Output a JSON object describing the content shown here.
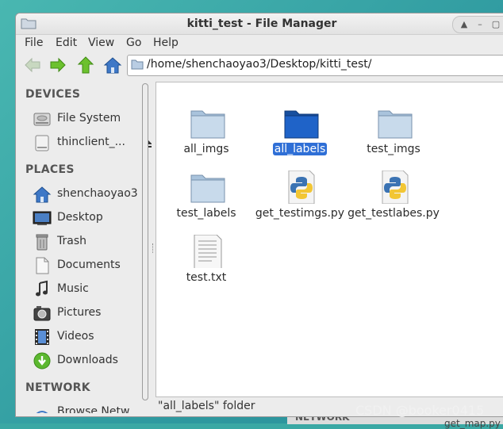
{
  "window": {
    "title": "kitti_test - File Manager"
  },
  "menu": {
    "items": [
      "File",
      "Edit",
      "View",
      "Go",
      "Help"
    ]
  },
  "toolbar": {
    "path": "/home/shenchaoyao3/Desktop/kitti_test/"
  },
  "sidebar": {
    "devices_header": "DEVICES",
    "devices": [
      {
        "label": "File System",
        "icon": "harddisk-icon"
      },
      {
        "label": "thinclient_...",
        "icon": "drive-icon",
        "eject": true
      }
    ],
    "places_header": "PLACES",
    "places": [
      {
        "label": "shenchaoyao3",
        "icon": "home-icon"
      },
      {
        "label": "Desktop",
        "icon": "desktop-icon"
      },
      {
        "label": "Trash",
        "icon": "trash-icon"
      },
      {
        "label": "Documents",
        "icon": "documents-icon"
      },
      {
        "label": "Music",
        "icon": "music-icon"
      },
      {
        "label": "Pictures",
        "icon": "pictures-icon"
      },
      {
        "label": "Videos",
        "icon": "videos-icon"
      },
      {
        "label": "Downloads",
        "icon": "downloads-icon"
      }
    ],
    "network_header": "NETWORK",
    "network": [
      {
        "label": "Browse Netw",
        "icon": "network-icon"
      }
    ]
  },
  "files": [
    {
      "name": "all_imgs",
      "type": "folder",
      "selected": false
    },
    {
      "name": "all_labels",
      "type": "folder",
      "selected": true
    },
    {
      "name": "test_imgs",
      "type": "folder",
      "selected": false
    },
    {
      "name": "test_labels",
      "type": "folder",
      "selected": false
    },
    {
      "name": "get_testimgs.py",
      "type": "python",
      "selected": false
    },
    {
      "name": "get_testlabes.py",
      "type": "python",
      "selected": false
    },
    {
      "name": "test.txt",
      "type": "text",
      "selected": false
    }
  ],
  "status": {
    "text": "\"all_labels\" folder"
  },
  "background": {
    "network_label": "NETWORK",
    "partial_file": "get_map.py"
  },
  "watermark": "CSDN @booker0415",
  "colors": {
    "selection": "#2f6fd6",
    "folder": "#8fb3d6",
    "selected_folder": "#1f5fc4"
  }
}
